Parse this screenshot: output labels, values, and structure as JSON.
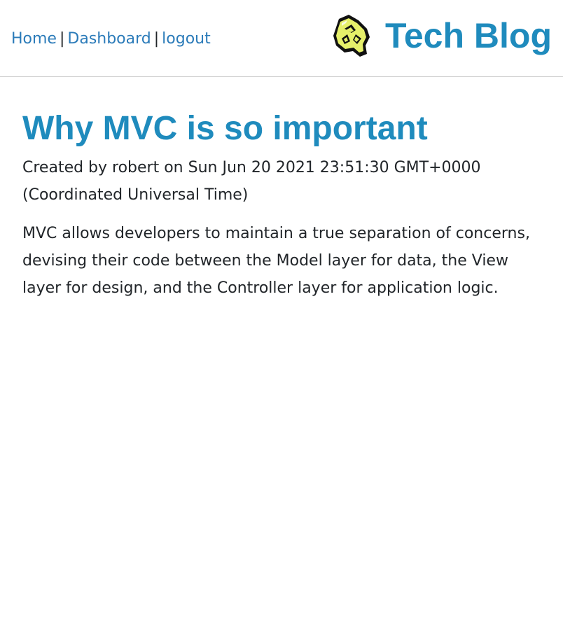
{
  "nav": {
    "home_label": "Home",
    "dashboard_label": "Dashboard",
    "logout_label": "logout",
    "separator": "|"
  },
  "brand": {
    "title": "Tech Blog",
    "logo_icon": "recycle-logo-icon"
  },
  "post": {
    "title": "Why MVC is so important",
    "meta": "Created by robert on Sun Jun 20 2021 23:51:30 GMT+0000 (Coordinated Universal Time)",
    "body": "MVC allows developers to maintain a true separation of concerns, devising their code between the Model layer for data, the View layer for design, and the Controller layer for application logic."
  },
  "colors": {
    "link": "#2b7bb9",
    "brand": "#1f8bbd",
    "text": "#212529",
    "logo_fill": "#e6f06a"
  }
}
